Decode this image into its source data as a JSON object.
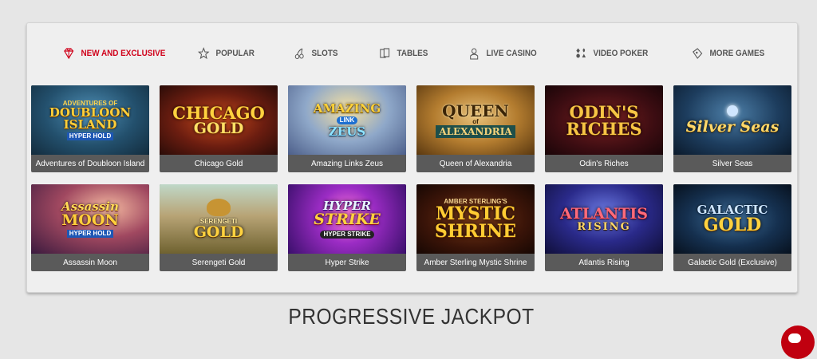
{
  "nav": {
    "tabs": [
      {
        "label": "NEW AND EXCLUSIVE",
        "icon": "diamond-icon",
        "active": true
      },
      {
        "label": "POPULAR",
        "icon": "star-icon",
        "active": false
      },
      {
        "label": "SLOTS",
        "icon": "cherry-icon",
        "active": false
      },
      {
        "label": "TABLES",
        "icon": "cards-icon",
        "active": false
      },
      {
        "label": "LIVE CASINO",
        "icon": "dealer-icon",
        "active": false
      },
      {
        "label": "VIDEO POKER",
        "icon": "card-suits-icon",
        "active": false
      },
      {
        "label": "MORE GAMES",
        "icon": "ticket-icon",
        "active": false
      }
    ]
  },
  "games": [
    {
      "title": "Adventures of Doubloon Island",
      "logo": [
        "ADVENTURES OF",
        "DOUBLOON",
        "ISLAND",
        "HYPER HOLD"
      ]
    },
    {
      "title": "Chicago Gold",
      "logo": [
        "CHICAGO",
        "GOLD"
      ]
    },
    {
      "title": "Amazing Links Zeus",
      "logo": [
        "AMAZING",
        "LINK",
        "ZEUS"
      ]
    },
    {
      "title": "Queen of Alexandria",
      "logo": [
        "QUEEN",
        "of",
        "ALEXANDRIA"
      ]
    },
    {
      "title": "Odin's Riches",
      "logo": [
        "ODIN'S",
        "RICHES"
      ]
    },
    {
      "title": "Silver Seas",
      "logo": [
        "Silver Seas"
      ]
    },
    {
      "title": "Assassin Moon",
      "logo": [
        "Assassin",
        "MOON",
        "HYPER HOLD"
      ]
    },
    {
      "title": "Serengeti Gold",
      "logo": [
        "SERENGETI",
        "GOLD"
      ]
    },
    {
      "title": "Hyper Strike",
      "logo": [
        "HYPER",
        "STRIKE",
        "HYPER STRIKE"
      ]
    },
    {
      "title": "Amber Sterling Mystic Shrine",
      "logo": [
        "AMBER STERLING'S",
        "MYSTIC",
        "SHRINE"
      ]
    },
    {
      "title": "Atlantis Rising",
      "logo": [
        "ATLANTIS",
        "RISING"
      ]
    },
    {
      "title": "Galactic Gold (Exclusive)",
      "logo": [
        "GALACTIC",
        "GOLD"
      ]
    }
  ],
  "section": {
    "heading": "PROGRESSIVE JACKPOT"
  },
  "colors": {
    "accent": "#d0021b",
    "tab_text": "#555555",
    "caption_bg": "#5a5a5a"
  }
}
